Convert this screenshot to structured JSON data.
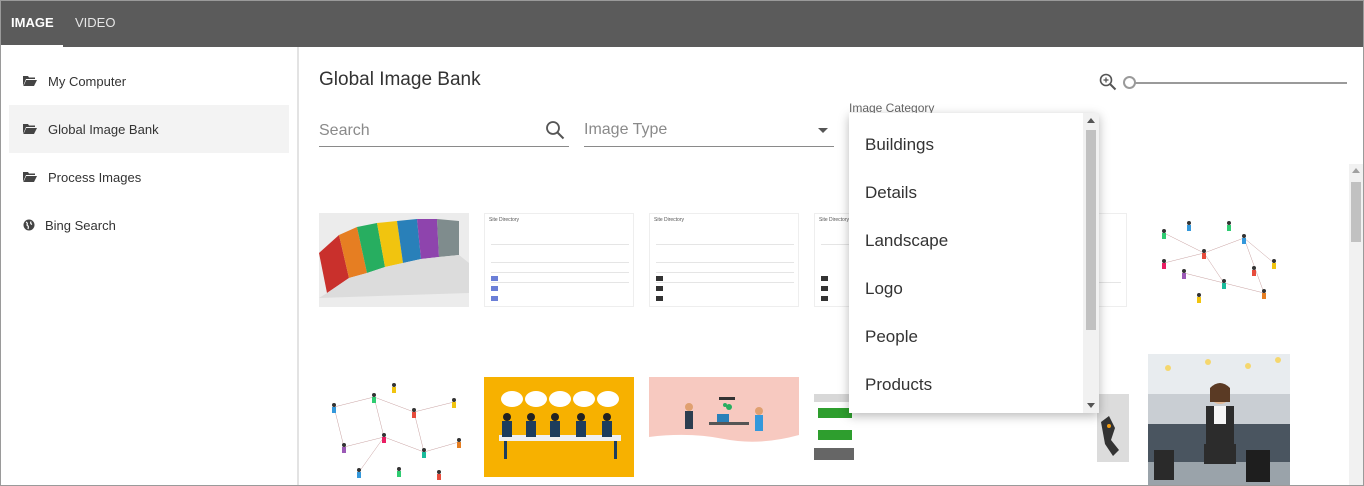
{
  "tabs": [
    {
      "label": "IMAGE",
      "active": true
    },
    {
      "label": "VIDEO",
      "active": false
    }
  ],
  "sidebar": {
    "items": [
      {
        "label": "My Computer",
        "icon": "folder-open-icon"
      },
      {
        "label": "Global Image Bank",
        "icon": "folder-open-icon",
        "active": true
      },
      {
        "label": "Process Images",
        "icon": "folder-open-icon"
      },
      {
        "label": "Bing Search",
        "icon": "globe-icon"
      }
    ]
  },
  "main": {
    "title": "Global Image Bank",
    "search": {
      "placeholder": "Search",
      "value": ""
    },
    "image_type": {
      "placeholder": "Image Type"
    },
    "image_category": {
      "label": "Image Category"
    },
    "zoom_level": 0
  },
  "dropdown": {
    "options": [
      "Buildings",
      "Details",
      "Landscape",
      "Logo",
      "People",
      "Products"
    ]
  },
  "thumbnails": {
    "site_directory_title": "Site Directory"
  },
  "colors": {
    "topbar": "#5b5b5b",
    "sidebar_active": "#f3f3f3",
    "yellow": "#f7b100",
    "green": "#2e9e2e"
  }
}
